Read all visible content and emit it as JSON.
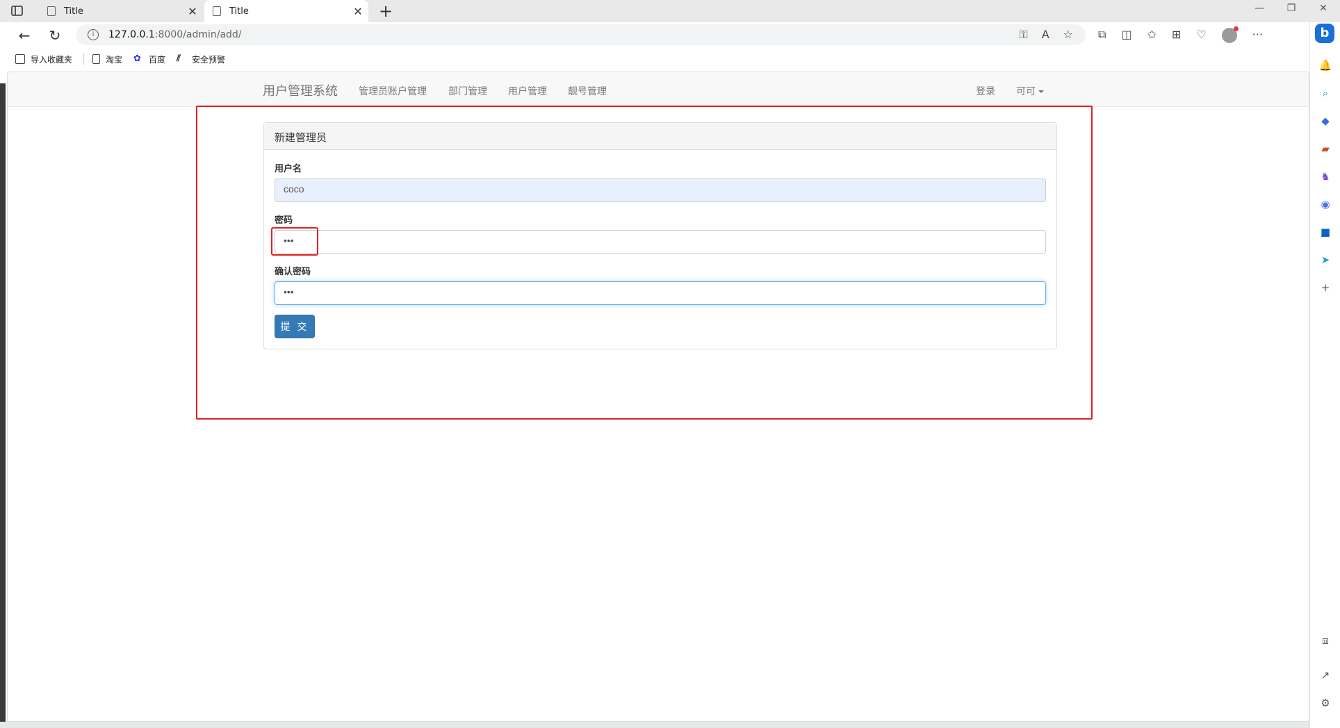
{
  "browser": {
    "tabs": [
      {
        "title": "Title",
        "active": false
      },
      {
        "title": "Title",
        "active": true
      }
    ],
    "url_host": "127.0.0.1",
    "url_path": ":8000/admin/add/",
    "bookmarks": [
      {
        "label": "导入收藏夹",
        "icon": "import-icon"
      },
      {
        "label": "淘宝",
        "icon": "page-icon"
      },
      {
        "label": "百度",
        "icon": "baidu-paw-icon"
      },
      {
        "label": "安全预警",
        "icon": "security-icon"
      }
    ]
  },
  "site": {
    "brand": "用户管理系统",
    "nav": [
      "管理员账户管理",
      "部门管理",
      "用户管理",
      "靓号管理"
    ],
    "login": "登录",
    "user_menu": "可可"
  },
  "panel": {
    "heading": "新建管理员",
    "fields": [
      {
        "label": "用户名",
        "value": "coco"
      },
      {
        "label": "密码",
        "value": "•••"
      },
      {
        "label": "确认密码",
        "value": "•••"
      }
    ],
    "submit": "提 交"
  },
  "colors": {
    "annotation": "#e02020",
    "primary_button": "#337ab7",
    "autofill": "#e8f0fe",
    "focus_border": "#66afe9"
  }
}
